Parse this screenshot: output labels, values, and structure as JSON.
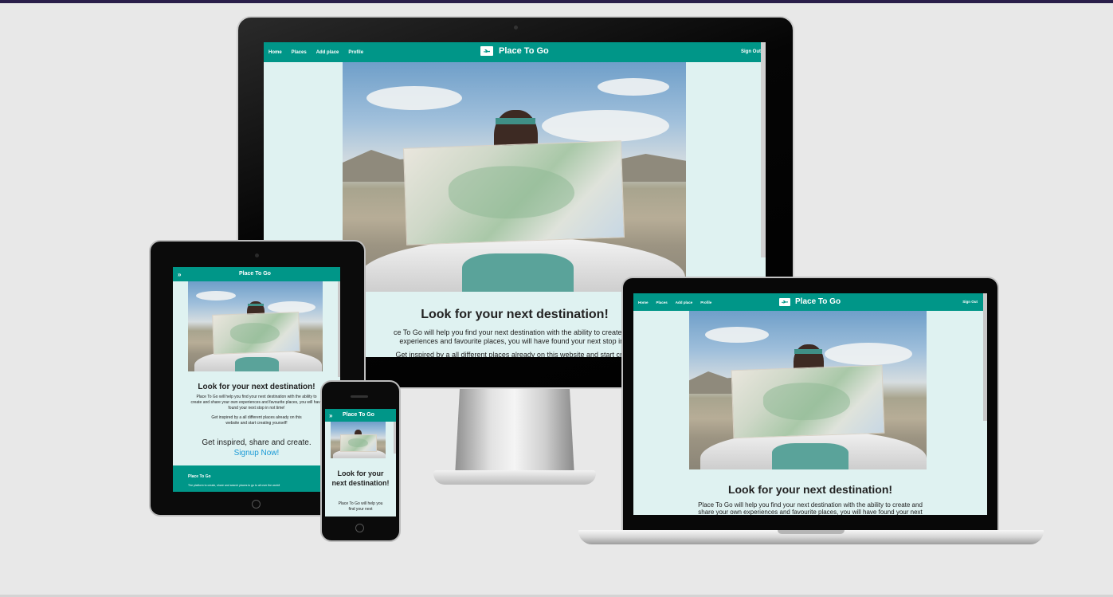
{
  "site": {
    "brand": "Place To Go",
    "nav": [
      "Home",
      "Places",
      "Add place",
      "Profile"
    ],
    "signout": "Sign Out",
    "heading": "Look for your next destination!",
    "intro_desktop": "ce To Go will help you find your next destination with the ability to create and",
    "intro_desktop_2": "experiences and favourite places, you will have found your next stop in n",
    "inspire_desktop": "Get inspired by a all different places already on this website and start creati",
    "intro_tablet": "Place To Go will help you find your next destination with the ability to create and share your own experiences and favourite places, you will have found your next stop in not time!",
    "inspire_tablet": "Get inspired by a all different places already on this website and start creating yourself!",
    "cta_line": "Get inspired, share and create.",
    "signup": "Signup Now!",
    "footer_title": "Place To Go",
    "footer_text": "The platform to create, share and search places to go to all over the world!",
    "phone_heading": "Look for your next destination!",
    "phone_intro": "Place To Go will help you find your next",
    "laptop_intro": "Place To Go will help you find your next destination with the ability to create and share your own experiences and favourite places, you will have found your next"
  },
  "icons": {
    "brand": "plane-icon",
    "menu": "double-chevron-icon"
  },
  "colors": {
    "primary": "#009688",
    "background": "#dff2f1",
    "link": "#1a9ad6",
    "page": "#e8e8e8"
  }
}
